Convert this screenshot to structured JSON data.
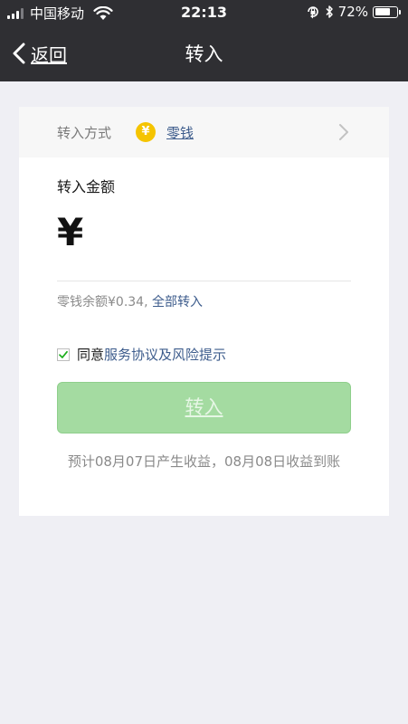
{
  "status_bar": {
    "carrier": "中国移动",
    "time": "22:13",
    "battery_percent": "72%",
    "battery_level": 0.72,
    "icons": [
      "signal-icon",
      "wifi-icon",
      "orientation-lock-icon",
      "bluetooth-icon",
      "battery-icon"
    ]
  },
  "nav": {
    "back_label": "返回",
    "title": "转入"
  },
  "transfer_method": {
    "label": "转入方式",
    "coin_symbol": "¥",
    "value": "零钱"
  },
  "amount": {
    "label": "转入金额",
    "currency": "¥",
    "value": ""
  },
  "balance": {
    "text": "零钱余额¥0.34,",
    "transfer_all": "全部转入"
  },
  "agreement": {
    "prefix": "同意",
    "link": "服务协议及风险提示",
    "checked": true
  },
  "submit_button": {
    "label": "转入"
  },
  "estimate": {
    "text": "预计08月07日产生收益，08月08日收益到账"
  },
  "colors": {
    "nav_bg": "#2f2f33",
    "link_blue": "#3d5c8c",
    "button_green": "#a4dba1",
    "coin_yellow": "#f5c400",
    "check_green": "#1aad19"
  }
}
